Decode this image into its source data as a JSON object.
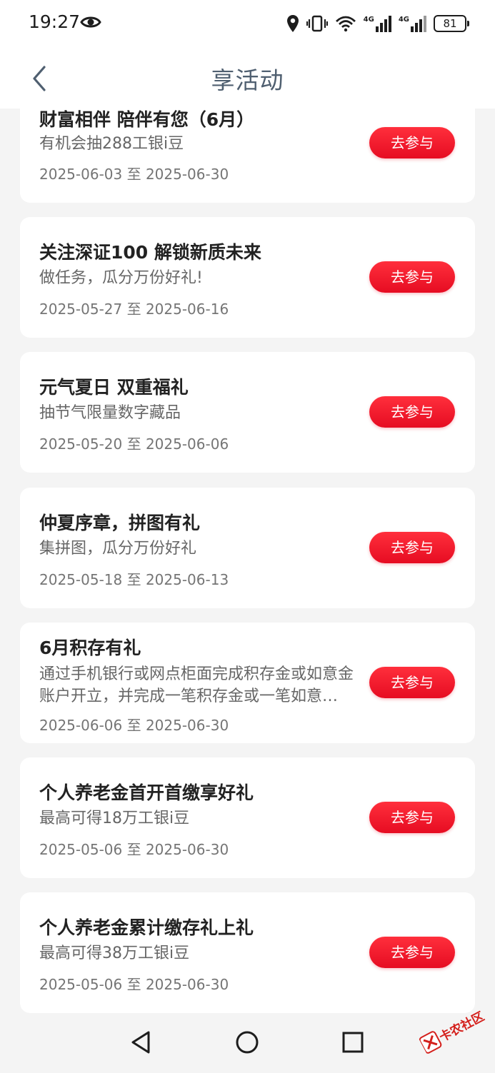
{
  "status_bar": {
    "time": "19:27",
    "battery": "81",
    "network_1": "4G",
    "network_2": "4G"
  },
  "header": {
    "title": "享活动",
    "back_icon": "chevron-left-icon"
  },
  "activities": [
    {
      "title": "财富相伴 陪伴有您（6月）",
      "desc": "有机会抽288工银i豆",
      "date": "2025-06-03 至 2025-06-30",
      "button": "去参与"
    },
    {
      "title": "关注深证100 解锁新质未来",
      "desc": "做任务，瓜分万份好礼!",
      "date": "2025-05-27 至 2025-06-16",
      "button": "去参与"
    },
    {
      "title": "元气夏日 双重福礼",
      "desc": "抽节气限量数字藏品",
      "date": "2025-05-20 至 2025-06-06",
      "button": "去参与"
    },
    {
      "title": "仲夏序章，拼图有礼",
      "desc": "集拼图，瓜分万份好礼",
      "date": "2025-05-18 至 2025-06-13",
      "button": "去参与"
    },
    {
      "title": "6月积存有礼",
      "desc": "通过手机银行或网点柜面完成积存金或如意金账户开立，并完成一笔积存金或一笔如意金购买",
      "date": "2025-06-06 至 2025-06-30",
      "button": "去参与"
    },
    {
      "title": "个人养老金首开首缴享好礼",
      "desc": "最高可得18万工银i豆",
      "date": "2025-05-06 至 2025-06-30",
      "button": "去参与"
    },
    {
      "title": "个人养老金累计缴存礼上礼",
      "desc": "最高可得38万工银i豆",
      "date": "2025-05-06 至 2025-06-30",
      "button": "去参与"
    }
  ],
  "watermark": {
    "text": "卡农社区"
  },
  "colors": {
    "accent_red": "#e60c22",
    "title_color": "#4f5f70",
    "background": "#f4f4f4"
  }
}
